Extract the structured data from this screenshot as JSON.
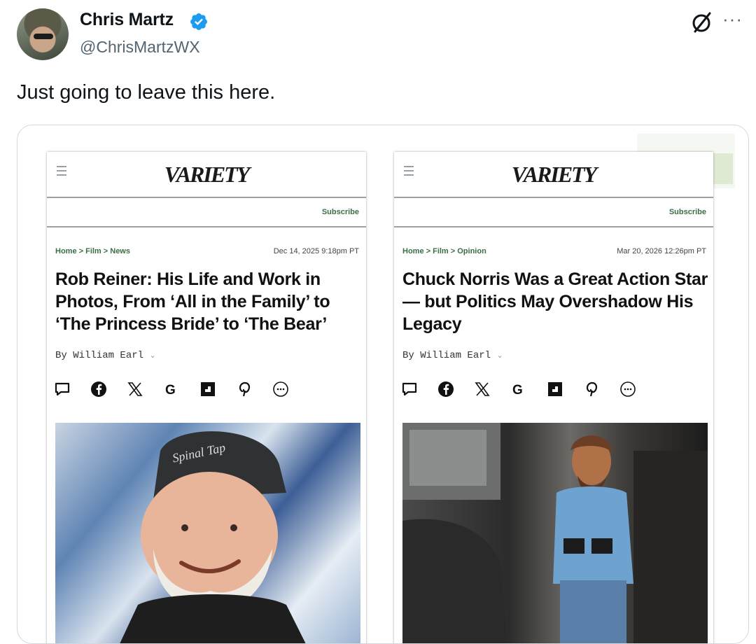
{
  "author": {
    "name": "Chris Martz",
    "handle": "@ChrisMartzWX"
  },
  "tweet": {
    "text": "Just going to leave this here."
  },
  "icons": {
    "verified": "verified-badge-icon",
    "grok": "grok-icon",
    "more": "more-icon"
  },
  "colors": {
    "verified": "#1d9bf0",
    "variety_green": "#3b6e44"
  },
  "articles": [
    {
      "logo": "VARIETY",
      "subscribe": "Subscribe",
      "breadcrumb": "Home > Film > News",
      "date": "Dec 14, 2025 9:18pm PT",
      "headline": "Rob Reiner: His Life and Work in Photos, From ‘All in the Family’ to ‘The Princess Bride’ to ‘The Bear’",
      "byline": "By William Earl",
      "photo_cap_text": "Spinal Tap"
    },
    {
      "logo": "VARIETY",
      "subscribe": "Subscribe",
      "breadcrumb": "Home > Film > Opinion",
      "date": "Mar 20, 2026 12:26pm PT",
      "headline": "Chuck Norris Was a Great Action Star — but Politics May Overshadow His Legacy",
      "byline": "By William Earl"
    }
  ],
  "share_icons": [
    "comment-icon",
    "facebook-icon",
    "x-icon",
    "google-icon",
    "flipboard-icon",
    "pinterest-icon",
    "more-share-icon"
  ]
}
